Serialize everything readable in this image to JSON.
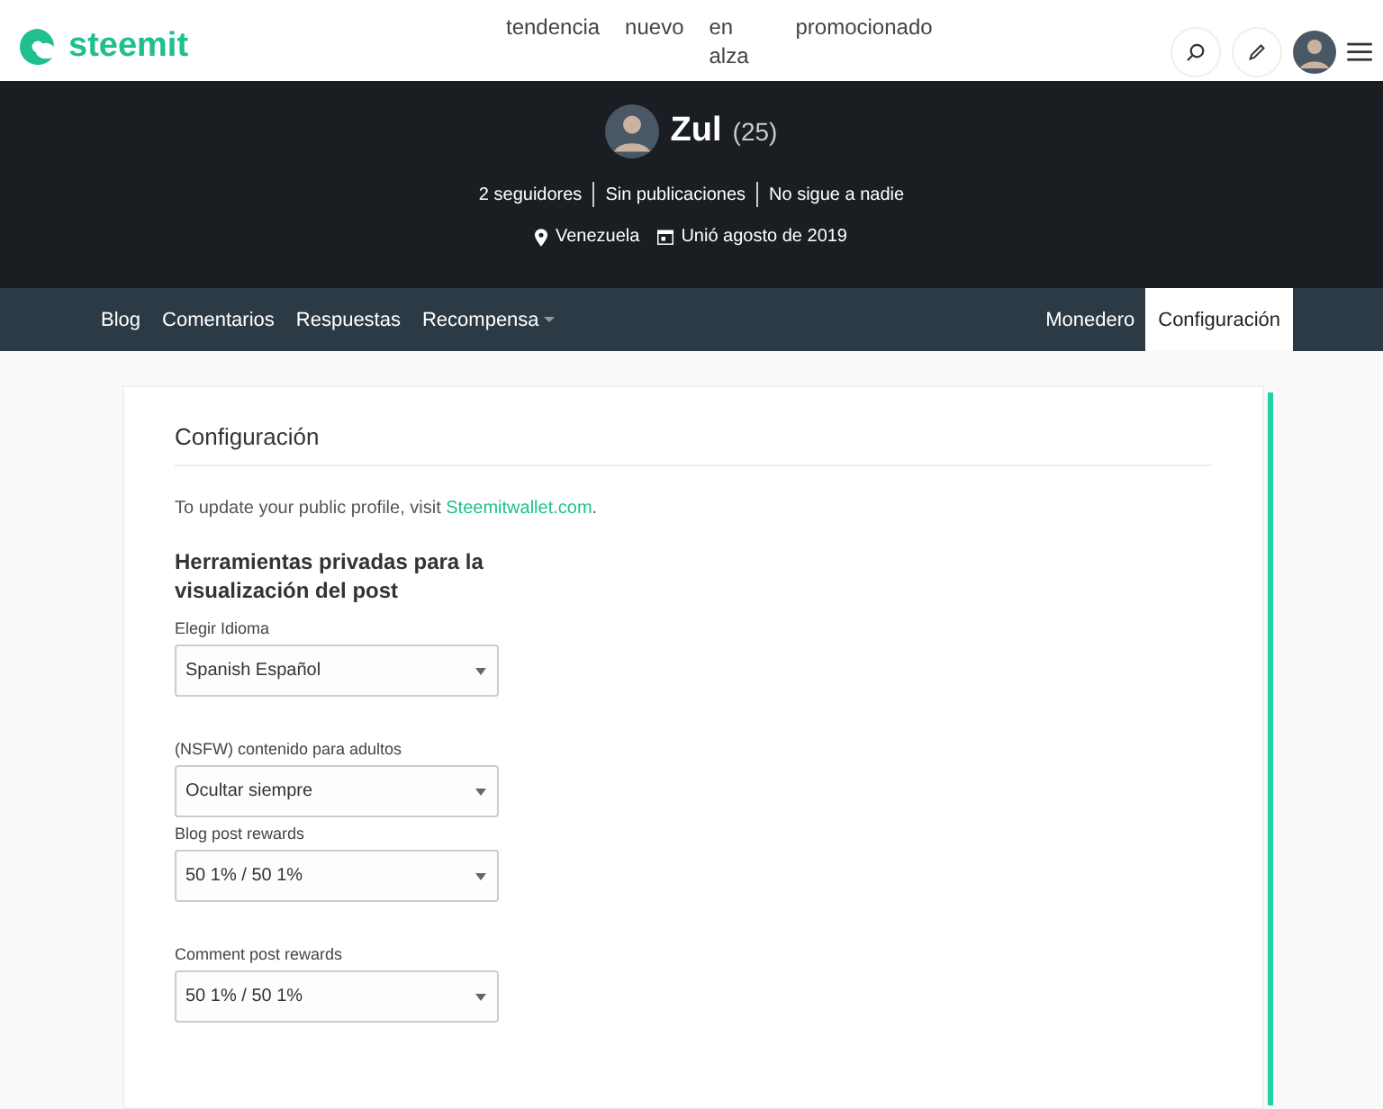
{
  "header": {
    "logo": "steemit",
    "nav": [
      {
        "label": "tendencia"
      },
      {
        "label": "nuevo"
      },
      {
        "label": "en alza"
      },
      {
        "label": "promocionado"
      }
    ]
  },
  "profile": {
    "name": "Zul",
    "reputation": "(25)",
    "stats": [
      "2 seguidores",
      "Sin publicaciones",
      "No sigue a nadie"
    ],
    "location": "Venezuela",
    "joined": "Unió agosto de 2019"
  },
  "tabs_left": [
    {
      "label": "Blog",
      "selected": false,
      "has_menu": false
    },
    {
      "label": "Comentarios",
      "selected": false,
      "has_menu": false
    },
    {
      "label": "Respuestas",
      "selected": false,
      "has_menu": false
    },
    {
      "label": "Recompensa",
      "selected": false,
      "has_menu": true
    }
  ],
  "tabs_right": [
    {
      "label": "Monedero",
      "selected": false
    },
    {
      "label": "Configuración",
      "selected": true
    }
  ],
  "settings": {
    "title": "Configuración",
    "notice": "To update your public profile, visit ",
    "notice_link": "Steemitwallet.com",
    "notice_end": ".",
    "section": "Herramientas privadas para la visualización del post",
    "fields": [
      {
        "label": "Elegir Idioma",
        "value": "Spanish Español"
      },
      {
        "label": "(NSFW) contenido para adultos",
        "value": "Ocultar siempre"
      },
      {
        "label": "Blog post rewards",
        "value": "50 1% / 50 1%"
      },
      {
        "label": "Comment post rewards",
        "value": "50 1% / 50 1%"
      }
    ]
  }
}
